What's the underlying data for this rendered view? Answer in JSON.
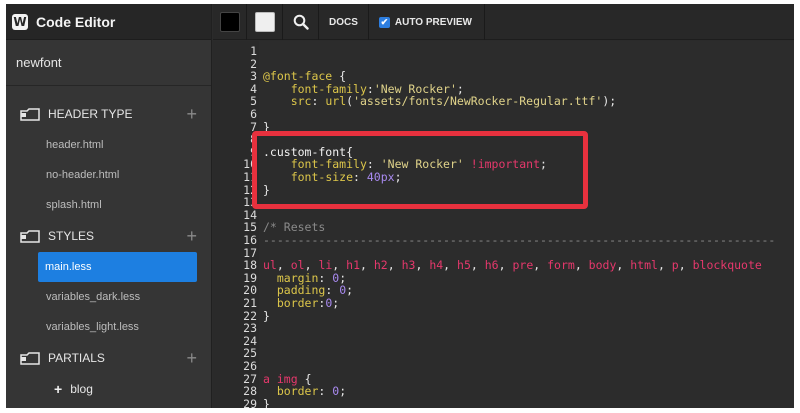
{
  "app": {
    "title": "Code Editor",
    "logo_letter": "W"
  },
  "sidebar": {
    "project_name": "newfont",
    "sections": [
      {
        "label": "HEADER TYPE",
        "files": [
          "header.html",
          "no-header.html",
          "splash.html"
        ]
      },
      {
        "label": "STYLES",
        "files": [
          "main.less",
          "variables_dark.less",
          "variables_light.less"
        ],
        "active_file": "main.less"
      },
      {
        "label": "PARTIALS",
        "subfolders": [
          "blog"
        ]
      }
    ]
  },
  "toolbar": {
    "swatch_dark_color": "#000000",
    "swatch_light_color": "#efefef",
    "search_icon": "search-icon",
    "docs_label": "DOCS",
    "auto_preview_label": "AUTO PREVIEW",
    "auto_preview_checked": true
  },
  "editor": {
    "lines": [
      {
        "n": "1",
        "code": ""
      },
      {
        "n": "2",
        "code": ""
      },
      {
        "n": "3",
        "code": "@font-face {"
      },
      {
        "n": "4",
        "code": "    font-family:'New Rocker';"
      },
      {
        "n": "5",
        "code": "    src: url('assets/fonts/NewRocker-Regular.ttf');"
      },
      {
        "n": "6",
        "code": ""
      },
      {
        "n": "7",
        "code": "}"
      },
      {
        "n": "8",
        "code": ""
      },
      {
        "n": "9",
        "code": ".custom-font{"
      },
      {
        "n": "10",
        "code": "    font-family: 'New Rocker' !important;"
      },
      {
        "n": "11",
        "code": "    font-size: 40px;"
      },
      {
        "n": "12",
        "code": "}"
      },
      {
        "n": "13",
        "code": ""
      },
      {
        "n": "14",
        "code": ""
      },
      {
        "n": "15",
        "code": "/* Resets"
      },
      {
        "n": "16",
        "code": "--------------------------------------------------------------------------"
      },
      {
        "n": "17",
        "code": ""
      },
      {
        "n": "18",
        "code": "ul, ol, li, h1, h2, h3, h4, h5, h6, pre, form, body, html, p, blockquote"
      },
      {
        "n": "19",
        "code": "  margin: 0;"
      },
      {
        "n": "20",
        "code": "  padding: 0;"
      },
      {
        "n": "21",
        "code": "  border:0;"
      },
      {
        "n": "22",
        "code": "}"
      },
      {
        "n": "23",
        "code": ""
      },
      {
        "n": "24",
        "code": ""
      },
      {
        "n": "25",
        "code": ""
      },
      {
        "n": "26",
        "code": ""
      },
      {
        "n": "27",
        "code": "a img {"
      },
      {
        "n": "28",
        "code": "  border: 0;"
      },
      {
        "n": "29",
        "code": "}"
      }
    ],
    "highlight_color": "#e8313e"
  }
}
